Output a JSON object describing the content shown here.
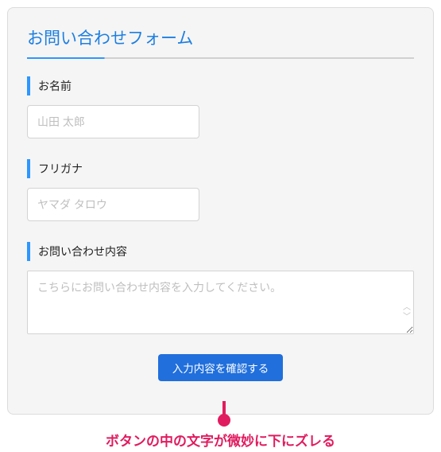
{
  "title": "お問い合わせフォーム",
  "fields": {
    "name": {
      "label": "お名前",
      "placeholder": "山田 太郎"
    },
    "furigana": {
      "label": "フリガナ",
      "placeholder": "ヤマダ タロウ"
    },
    "inquiry": {
      "label": "お問い合わせ内容",
      "placeholder": "こちらにお問い合わせ内容を入力してください。"
    }
  },
  "submit_label": "入力内容を確認する",
  "annotation": "ボタンの中の文字が微妙に下にズレる"
}
